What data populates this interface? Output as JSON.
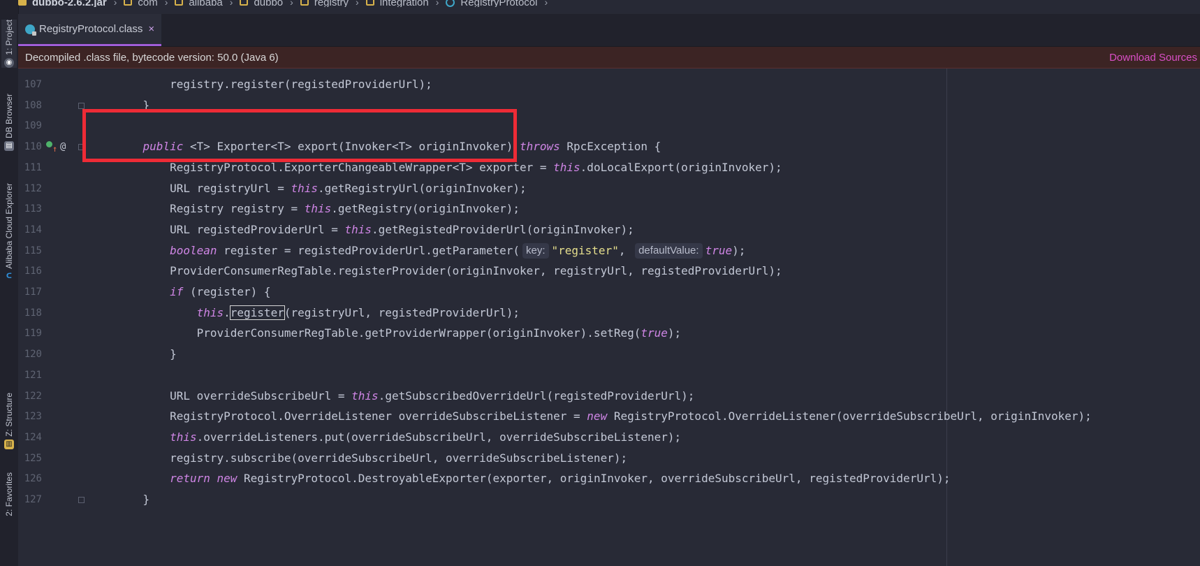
{
  "toolwindows": [
    {
      "label": "1: Project",
      "icon": "project-icon"
    },
    {
      "label": "DB Browser",
      "icon": "db-browser-icon"
    },
    {
      "label": "Alibaba Cloud Explorer",
      "icon": "alibaba-cloud-icon"
    },
    {
      "label": "Z: Structure",
      "icon": "structure-icon"
    },
    {
      "label": "2: Favorites",
      "icon": "favorites-icon"
    }
  ],
  "breadcrumb": [
    "dubbo-2.6.2.jar",
    "com",
    "alibaba",
    "dubbo",
    "registry",
    "integration",
    "RegistryProtocol"
  ],
  "tab": {
    "label": "RegistryProtocol.class",
    "close": "×"
  },
  "banner": {
    "message": "Decompiled .class file, bytecode version: 50.0 (Java 6)",
    "action": "Download Sources"
  },
  "colors": {
    "keyword": "#d086e6",
    "string": "#e6df8d",
    "highlight_box": "#ee2b36",
    "accent": "#a15ed8"
  },
  "code_lines": [
    {
      "num": "107",
      "parts": [
        {
          "t": "        registry.register(registedProviderUrl);"
        }
      ]
    },
    {
      "num": "108",
      "parts": [
        {
          "t": "    }"
        }
      ]
    },
    {
      "num": "109",
      "parts": [
        {
          "t": ""
        }
      ]
    },
    {
      "num": "110",
      "parts": [
        {
          "t": "    "
        },
        {
          "t": "public",
          "c": "kw"
        },
        {
          "t": " <T> Exporter<T> export(Invoker<T> originInvoker) "
        },
        {
          "t": "throws",
          "c": "kw"
        },
        {
          "t": " RpcException {"
        }
      ]
    },
    {
      "num": "111",
      "parts": [
        {
          "t": "        RegistryProtocol.ExporterChangeableWrapper<T> exporter = "
        },
        {
          "t": "this",
          "c": "kw"
        },
        {
          "t": ".doLocalExport(originInvoker);"
        }
      ]
    },
    {
      "num": "112",
      "parts": [
        {
          "t": "        URL registryUrl = "
        },
        {
          "t": "this",
          "c": "kw"
        },
        {
          "t": ".getRegistryUrl(originInvoker);"
        }
      ]
    },
    {
      "num": "113",
      "parts": [
        {
          "t": "        Registry registry = "
        },
        {
          "t": "this",
          "c": "kw"
        },
        {
          "t": ".getRegistry(originInvoker);"
        }
      ]
    },
    {
      "num": "114",
      "parts": [
        {
          "t": "        URL registedProviderUrl = "
        },
        {
          "t": "this",
          "c": "kw"
        },
        {
          "t": ".getRegistedProviderUrl(originInvoker);"
        }
      ]
    },
    {
      "num": "115",
      "parts": [
        {
          "t": "        "
        },
        {
          "t": "boolean",
          "c": "kw"
        },
        {
          "t": " register = registedProviderUrl.getParameter("
        },
        {
          "t": "key:",
          "c": "hint"
        },
        {
          "t": "\"register\"",
          "c": "str"
        },
        {
          "t": ", "
        },
        {
          "t": "defaultValue:",
          "c": "hint"
        },
        {
          "t": "true",
          "c": "kw"
        },
        {
          "t": ");"
        }
      ]
    },
    {
      "num": "116",
      "parts": [
        {
          "t": "        ProviderConsumerRegTable.registerProvider(originInvoker, registryUrl, registedProviderUrl);"
        }
      ]
    },
    {
      "num": "117",
      "parts": [
        {
          "t": "        "
        },
        {
          "t": "if",
          "c": "kw"
        },
        {
          "t": " (register) {"
        }
      ]
    },
    {
      "num": "118",
      "parts": [
        {
          "t": "            "
        },
        {
          "t": "this",
          "c": "kw"
        },
        {
          "t": "."
        },
        {
          "t": "register",
          "c": "boxed"
        },
        {
          "t": "(registryUrl, registedProviderUrl);"
        }
      ]
    },
    {
      "num": "119",
      "parts": [
        {
          "t": "            ProviderConsumerRegTable.getProviderWrapper(originInvoker).setReg("
        },
        {
          "t": "true",
          "c": "kw"
        },
        {
          "t": ");"
        }
      ]
    },
    {
      "num": "120",
      "parts": [
        {
          "t": "        }"
        }
      ]
    },
    {
      "num": "121",
      "parts": [
        {
          "t": ""
        }
      ]
    },
    {
      "num": "122",
      "parts": [
        {
          "t": "        URL overrideSubscribeUrl = "
        },
        {
          "t": "this",
          "c": "kw"
        },
        {
          "t": ".getSubscribedOverrideUrl(registedProviderUrl);"
        }
      ]
    },
    {
      "num": "123",
      "parts": [
        {
          "t": "        RegistryProtocol.OverrideListener overrideSubscribeListener = "
        },
        {
          "t": "new",
          "c": "kw"
        },
        {
          "t": " RegistryProtocol.OverrideListener(overrideSubscribeUrl, originInvoker);"
        }
      ]
    },
    {
      "num": "124",
      "parts": [
        {
          "t": "        "
        },
        {
          "t": "this",
          "c": "kw"
        },
        {
          "t": ".overrideListeners.put(overrideSubscribeUrl, overrideSubscribeListener);"
        }
      ]
    },
    {
      "num": "125",
      "parts": [
        {
          "t": "        registry.subscribe(overrideSubscribeUrl, overrideSubscribeListener);"
        }
      ]
    },
    {
      "num": "126",
      "parts": [
        {
          "t": "        "
        },
        {
          "t": "return",
          "c": "kw"
        },
        {
          "t": " "
        },
        {
          "t": "new",
          "c": "kw"
        },
        {
          "t": " RegistryProtocol.DestroyableExporter(exporter, originInvoker, overrideSubscribeUrl, registedProviderUrl);"
        }
      ]
    },
    {
      "num": "127",
      "parts": [
        {
          "t": "    }"
        }
      ]
    }
  ]
}
